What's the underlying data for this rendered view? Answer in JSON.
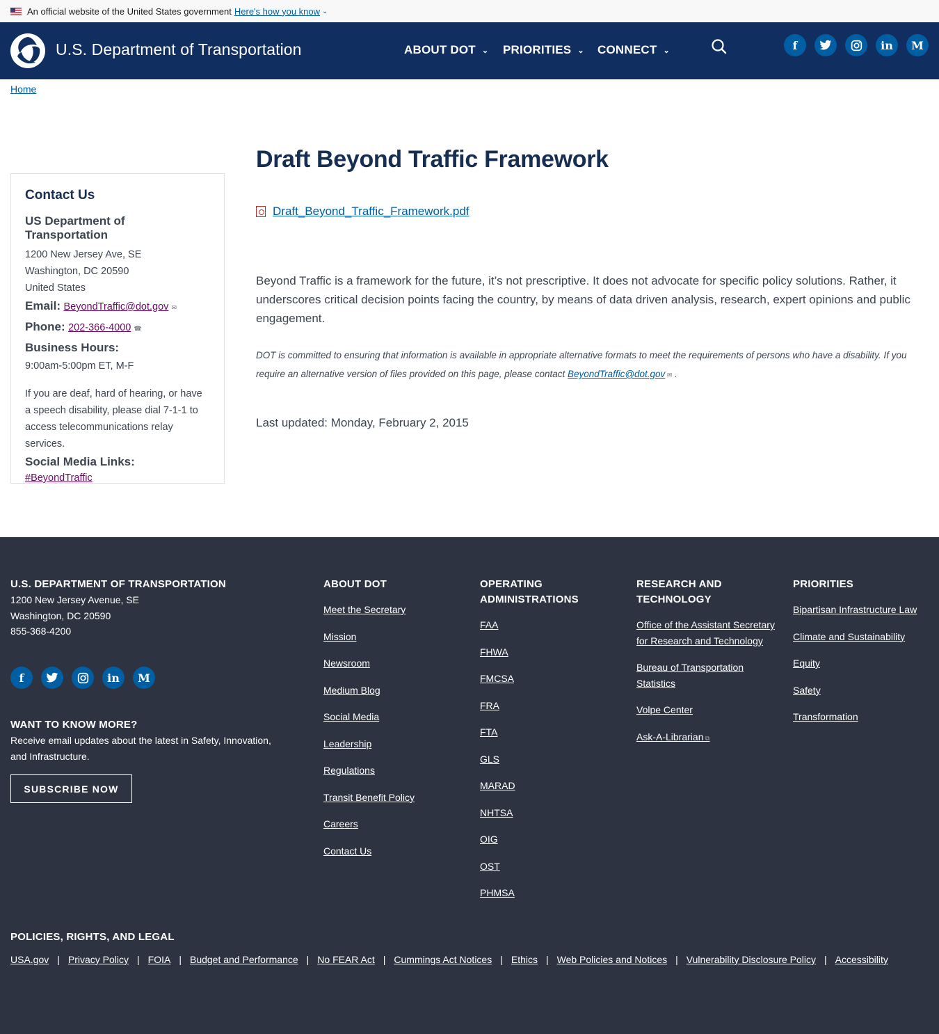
{
  "gov_banner": {
    "text": "An official website of the United States government",
    "link": "Here's how you know"
  },
  "header": {
    "brand": "U.S. Department of Transportation",
    "nav": [
      "ABOUT DOT",
      "PRIORITIES",
      "CONNECT"
    ],
    "social": [
      {
        "icon": "facebook-icon",
        "glyph": "f"
      },
      {
        "icon": "twitter-icon",
        "glyph": "t"
      },
      {
        "icon": "instagram-icon",
        "glyph": "◎"
      },
      {
        "icon": "linkedin-icon",
        "glyph": "in"
      },
      {
        "icon": "medium-icon",
        "glyph": "M"
      }
    ]
  },
  "breadcrumb": "Home",
  "sidebar": {
    "title": "Contact Us",
    "org": "US Department of Transportation",
    "address": [
      "1200 New Jersey Ave, SE",
      "Washington, DC 20590",
      "United States"
    ],
    "email_label": "Email:",
    "email": "BeyondTraffic@dot.gov",
    "phone_label": "Phone:",
    "phone": "202-366-4000",
    "hours_label": "Business Hours:",
    "hours": "9:00am-5:00pm ET, M-F",
    "tty": "If you are deaf, hard of hearing, or have a speech disability, please dial 7-1-1 to access telecommunications relay services.",
    "social_label": "Social Media Links:",
    "hashtag": "#BeyondTraffic"
  },
  "main": {
    "title": "Draft Beyond Traffic Framework",
    "file": "Draft_Beyond_Traffic_Framework.pdf",
    "intro": "Beyond Traffic is a framework for the future, it’s not prescriptive.  It does not advocate for specific policy solutions.  Rather, it underscores critical decision points facing the country, by means of data driven analysis, research, expert opinions and public engagement.",
    "note_text": "DOT is committed to ensuring that information is available in appropriate alternative formats to meet the requirements of persons who have a disability. If you require an alternative version of files provided on this page, please contact ",
    "note_email": "BeyondTraffic@dot.gov",
    "note_end": " .",
    "updated": "Last updated: Monday, February 2, 2015"
  },
  "footer": {
    "org_title": "U.S. Department of Transportation",
    "address": [
      "1200 New Jersey Avenue, SE",
      "Washington, DC 20590",
      "855-368-4200"
    ],
    "more_title": "Want to know more?",
    "more_text": "Receive email updates about the latest in Safety, Innovation, and Infrastructure.",
    "subscribe": "SUBSCRIBE NOW",
    "about_title": "About DOT",
    "about_links": [
      "Meet the Secretary",
      "Mission",
      "Newsroom",
      "Medium Blog",
      "Social Media",
      "Leadership",
      "Regulations",
      "Transit Benefit Policy",
      "Careers",
      "Contact Us"
    ],
    "ops_title": "Operating Administrations",
    "ops_links": [
      "FAA",
      "FHWA",
      "FMCSA",
      "FRA",
      "FTA",
      "GLS",
      "MARAD",
      "NHTSA",
      "OIG",
      "OST",
      "PHMSA"
    ],
    "research_title": "Research and Technology",
    "research_links": [
      "Office of the Assistant Secretary for Research and Technology",
      "Bureau of Transportation Statistics",
      "Volpe Center",
      "Ask-A-Librarian"
    ],
    "priorities_title": "Priorities",
    "priorities_links": [
      "Bipartisan Infrastructure Law",
      "Climate and Sustainability",
      "Equity",
      "Safety",
      "Transformation"
    ],
    "policies_title": "Policies, Rights, and Legal",
    "policies_links": [
      "USA.gov",
      "Privacy Policy",
      "FOIA",
      "Budget and Performance",
      "No FEAR Act",
      "Cummings Act Notices",
      "Ethics",
      "Web Policies and Notices",
      "Vulnerability Disclosure Policy",
      "Accessibility"
    ]
  }
}
